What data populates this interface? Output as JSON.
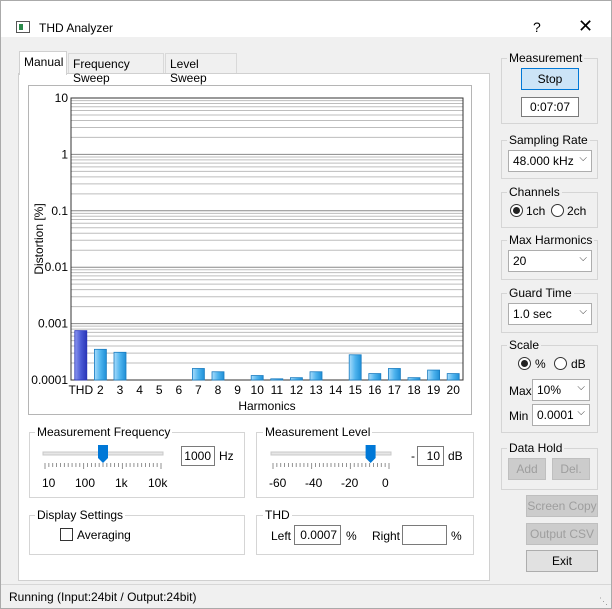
{
  "window": {
    "title": "THD Analyzer",
    "help": "?",
    "close": "✕"
  },
  "tabs": [
    "Manual",
    "Frequency Sweep",
    "Level Sweep"
  ],
  "chart_data": {
    "type": "bar",
    "ylabel": "Distortion [%]",
    "xlabel": "Harmonics",
    "yscale": "log",
    "ylim": [
      0.0001,
      10
    ],
    "ytick_labels": [
      "10",
      "1",
      "0.1",
      "0.01",
      "0.001",
      "0.0001"
    ],
    "categories": [
      "THD",
      "2",
      "3",
      "4",
      "5",
      "6",
      "7",
      "8",
      "9",
      "10",
      "11",
      "12",
      "13",
      "14",
      "15",
      "16",
      "17",
      "18",
      "19",
      "20"
    ],
    "values": [
      0.00075,
      0.00035,
      0.00031,
      null,
      null,
      null,
      0.00016,
      0.00014,
      null,
      0.00012,
      0.000105,
      0.00011,
      0.00014,
      null,
      0.00028,
      0.00013,
      0.00016,
      0.00011,
      0.00015,
      0.00013
    ],
    "colors": {
      "thd": "#4b5bd6",
      "harmonic": "#4fb4ee"
    },
    "grid": true
  },
  "freq": {
    "title": "Measurement Frequency",
    "value": "1000",
    "unit": "Hz",
    "ticks": [
      "10",
      "100",
      "1k",
      "10k"
    ],
    "slider_fraction": 0.5
  },
  "level": {
    "title": "Measurement Level",
    "sign": "-",
    "value": "10",
    "unit": "dB",
    "ticks": [
      "-60",
      "-40",
      "-20",
      "0"
    ],
    "slider_fraction": 0.83
  },
  "display": {
    "title": "Display Settings",
    "averaging": "Averaging"
  },
  "thd": {
    "title": "THD",
    "left_label": "Left",
    "left_value": "0.0007",
    "right_label": "Right",
    "right_value": "",
    "unit": "%"
  },
  "measurement": {
    "title": "Measurement",
    "stop": "Stop",
    "time": "0:07:07"
  },
  "sampling": {
    "title": "Sampling Rate",
    "value": "48.000 kHz"
  },
  "channels": {
    "title": "Channels",
    "opt1": "1ch",
    "opt2": "2ch"
  },
  "max_harmonics": {
    "title": "Max Harmonics",
    "value": "20"
  },
  "guard": {
    "title": "Guard Time",
    "value": "1.0 sec"
  },
  "scale": {
    "title": "Scale",
    "opt_pct": "%",
    "opt_db": "dB",
    "max_label": "Max",
    "max_value": "10%",
    "min_label": "Min",
    "min_value": "0.0001"
  },
  "datahold": {
    "title": "Data Hold",
    "add": "Add",
    "del": "Del."
  },
  "actions": {
    "screen_copy": "Screen Copy",
    "output_csv": "Output CSV",
    "exit": "Exit"
  },
  "status": "Running (Input:24bit / Output:24bit)"
}
